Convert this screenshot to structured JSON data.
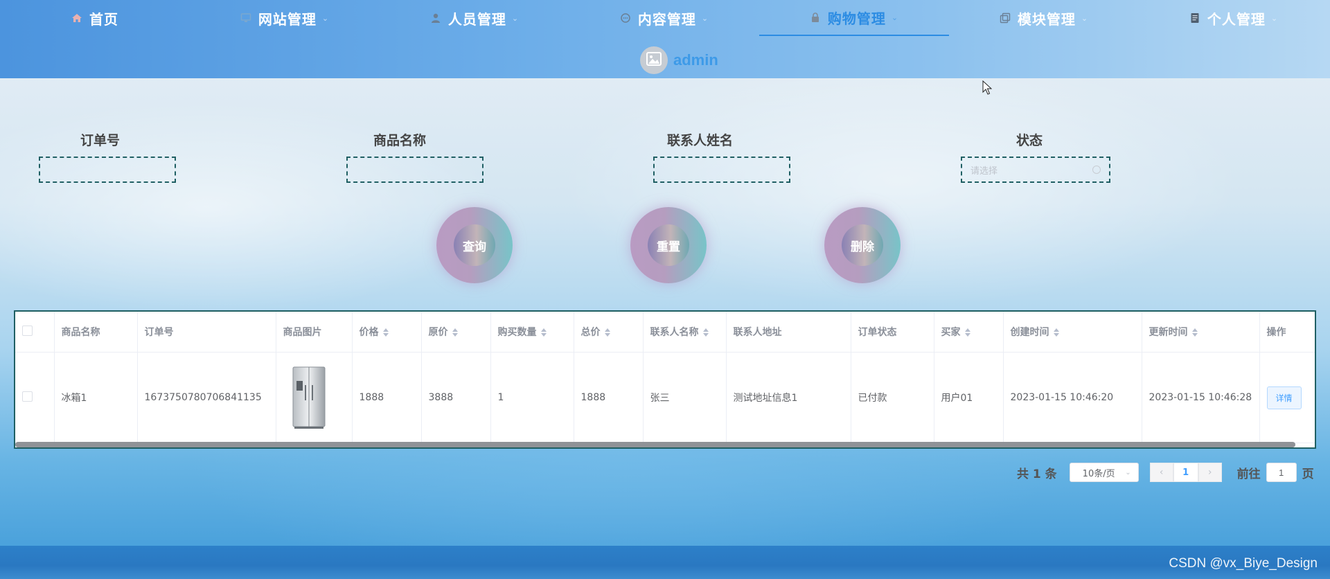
{
  "nav": {
    "items": [
      {
        "label": "首页",
        "icon": "home-icon",
        "active": false
      },
      {
        "label": "网站管理",
        "icon": "monitor-icon",
        "active": false
      },
      {
        "label": "人员管理",
        "icon": "user-icon",
        "active": false
      },
      {
        "label": "内容管理",
        "icon": "chat-icon",
        "active": false
      },
      {
        "label": "购物管理",
        "icon": "lock-icon",
        "active": true
      },
      {
        "label": "模块管理",
        "icon": "copy-icon",
        "active": false
      },
      {
        "label": "个人管理",
        "icon": "document-icon",
        "active": false
      }
    ],
    "active_color": "#2c8ce3"
  },
  "user": {
    "name": "admin",
    "avatar_icon": "image-icon"
  },
  "search": {
    "order_no_label": "订单号",
    "order_no_value": "",
    "product_name_label": "商品名称",
    "product_name_value": "",
    "contact_name_label": "联系人姓名",
    "contact_name_value": "",
    "status_label": "状态",
    "status_placeholder": "请选择"
  },
  "actions": {
    "query": "查询",
    "reset": "重置",
    "delete": "删除"
  },
  "table": {
    "headers": {
      "product_name": "商品名称",
      "order_no": "订单号",
      "product_image": "商品图片",
      "price": "价格",
      "original_price": "原价",
      "quantity": "购买数量",
      "total": "总价",
      "contact_name": "联系人名称",
      "contact_address": "联系人地址",
      "order_status": "订单状态",
      "buyer": "买家",
      "created_at": "创建时间",
      "updated_at": "更新时间",
      "operation": "操作"
    },
    "rows": [
      {
        "product_name": "冰箱1",
        "order_no": "1673750780706841135",
        "product_image_icon": "fridge-image",
        "price": "1888",
        "original_price": "3888",
        "quantity": "1",
        "total": "1888",
        "contact_name": "张三",
        "contact_address": "测试地址信息1",
        "order_status": "已付款",
        "buyer": "用户01",
        "created_at": "2023-01-15 10:46:20",
        "updated_at": "2023-01-15 10:46:28",
        "detail_label": "详情"
      }
    ]
  },
  "pagination": {
    "total_text": "共 1 条",
    "page_size": "10条/页",
    "current_page": "1",
    "goto_prefix": "前往",
    "goto_value": "1",
    "goto_suffix": "页"
  },
  "watermark": "CSDN @vx_Biye_Design"
}
